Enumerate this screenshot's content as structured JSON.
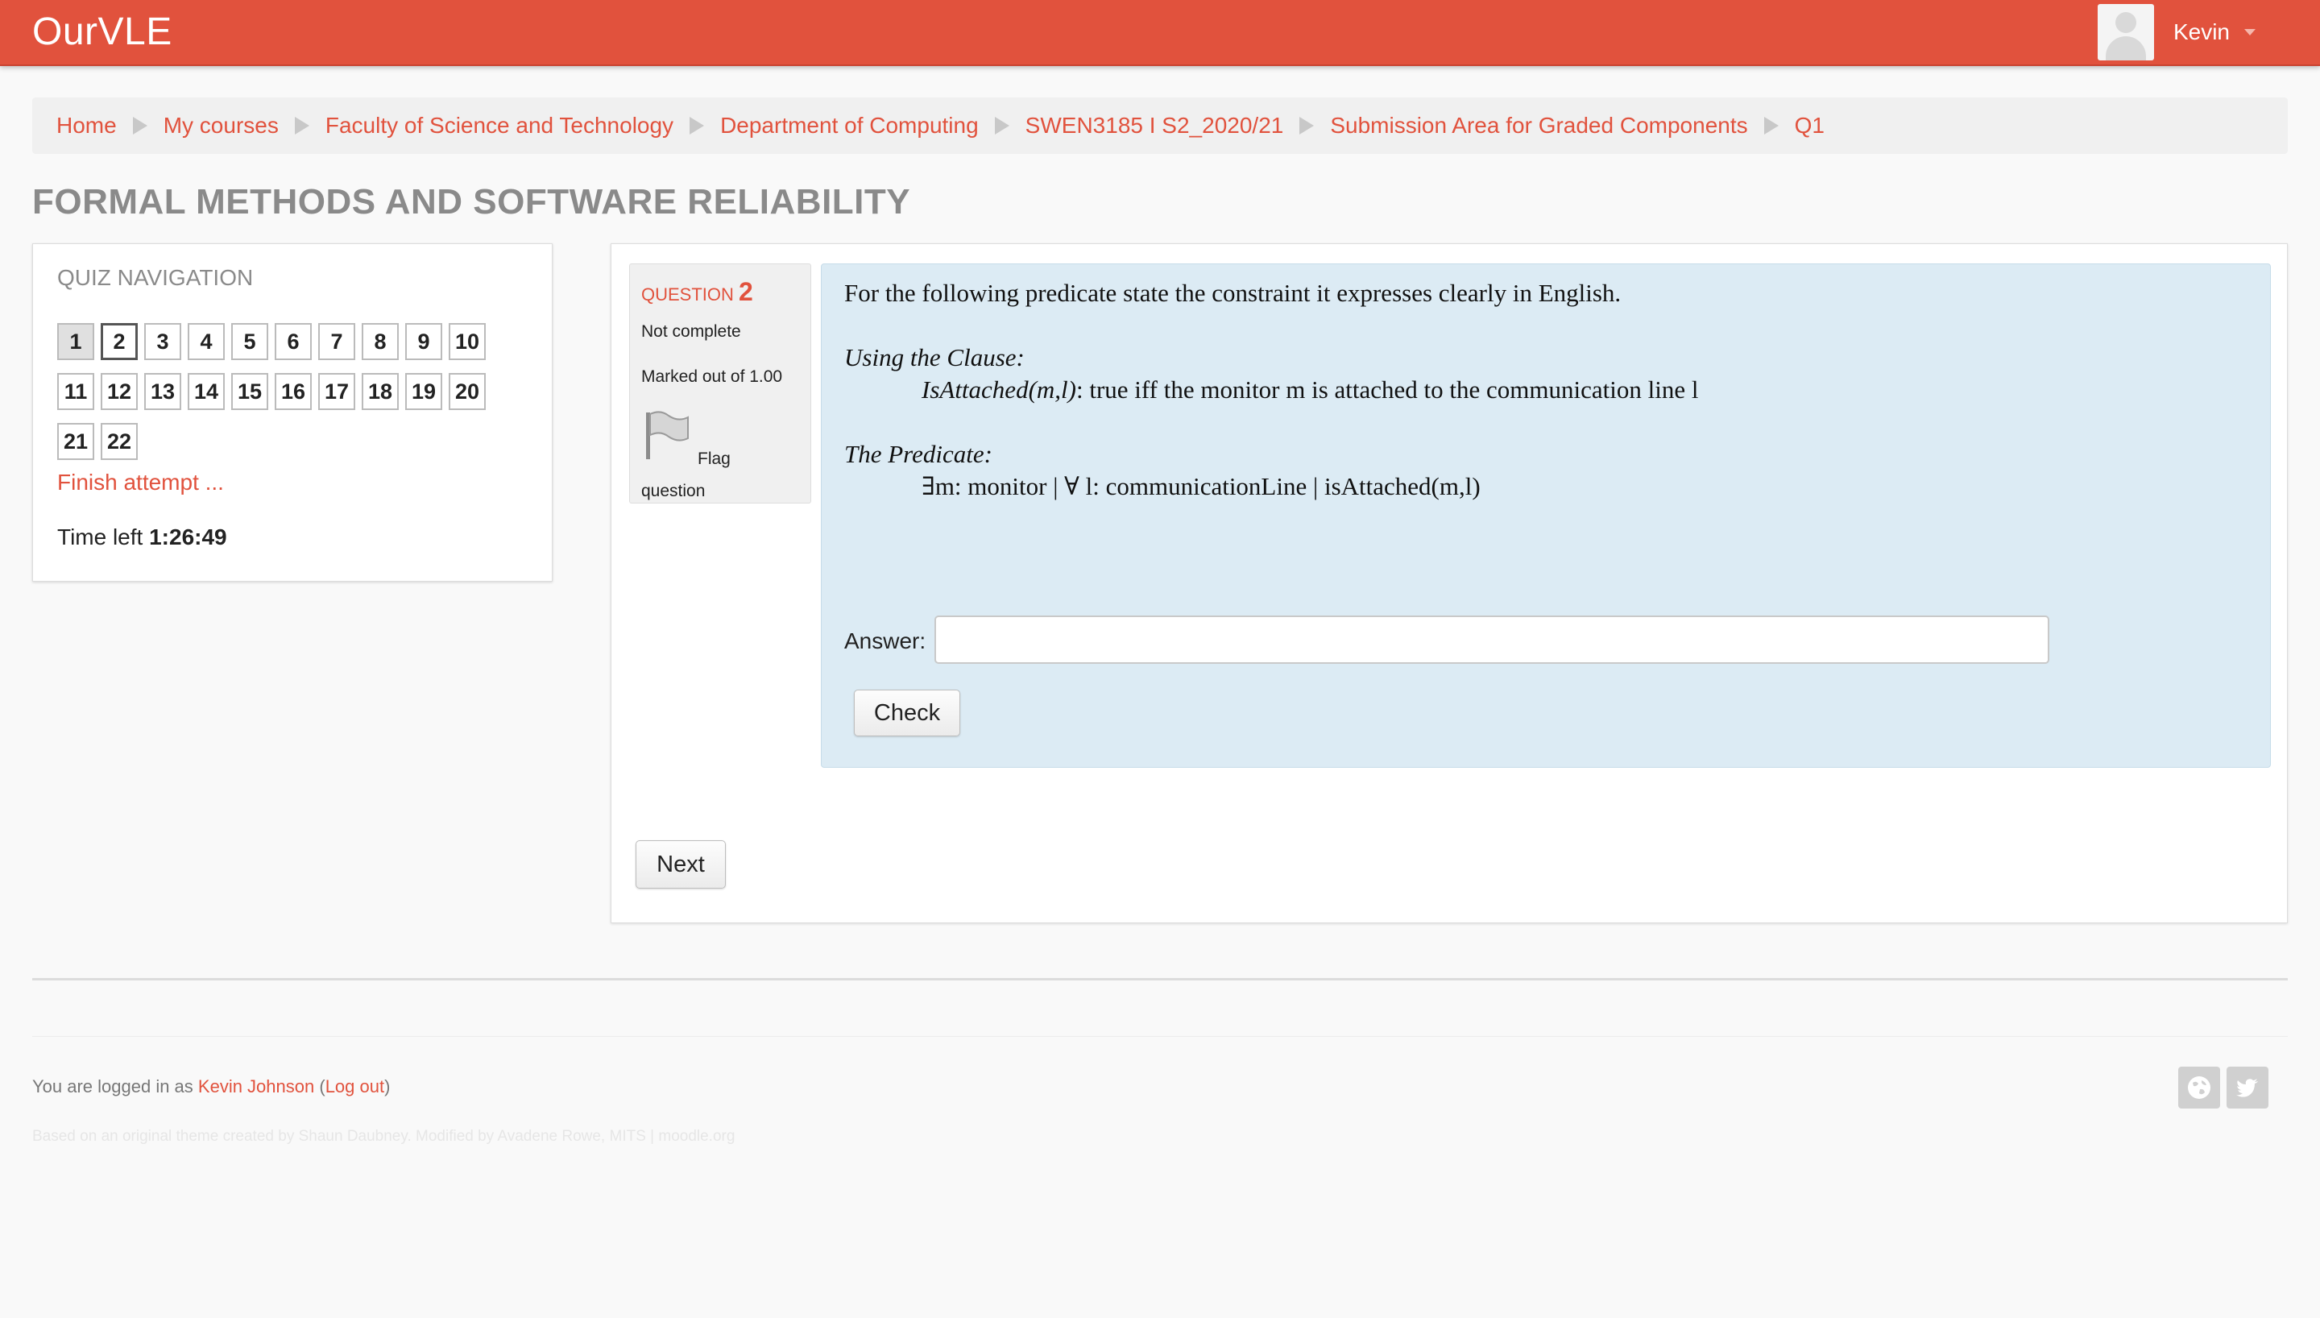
{
  "app": {
    "brand": "OurVLE"
  },
  "user": {
    "name": "Kevin"
  },
  "breadcrumb": [
    "Home",
    "My courses",
    "Faculty of Science and Technology",
    "Department of Computing",
    "SWEN3185 I S2_2020/21",
    "Submission Area for Graded Components",
    "Q1"
  ],
  "page": {
    "title": "FORMAL METHODS AND SOFTWARE RELIABILITY"
  },
  "quiz_nav": {
    "title": "QUIZ NAVIGATION",
    "questions": [
      "1",
      "2",
      "3",
      "4",
      "5",
      "6",
      "7",
      "8",
      "9",
      "10",
      "11",
      "12",
      "13",
      "14",
      "15",
      "16",
      "17",
      "18",
      "19",
      "20",
      "21",
      "22"
    ],
    "finish_label": "Finish attempt ...",
    "time_left_label": "Time left",
    "time_left_value": "1:26:49"
  },
  "question": {
    "label": "QUESTION",
    "number": "2",
    "state": "Not complete",
    "grade": "Marked out of 1.00",
    "flag_label_1": "Flag",
    "flag_label_2": "question",
    "prompt": "For the following predicate state the constraint it expresses clearly in English.",
    "clause_heading": "Using the  Clause:",
    "clause_name": "IsAttached(m,l)",
    "clause_def": ": true iff the monitor m is attached to the communication line l",
    "predicate_heading": "The Predicate:",
    "predicate": "∃m: monitor | ∀ l: communicationLine | isAttached(m,l)",
    "answer_label": "Answer:",
    "answer_value": "",
    "check_label": "Check"
  },
  "nav": {
    "next_label": "Next"
  },
  "footer": {
    "logged_in_prefix": "You are logged in as ",
    "user_full_name": "Kevin Johnson",
    "logout_label": "Log out",
    "credits": "Based on an original theme created by Shaun Daubney. Modified by Avadene Rowe, MITS | moodle.org"
  }
}
